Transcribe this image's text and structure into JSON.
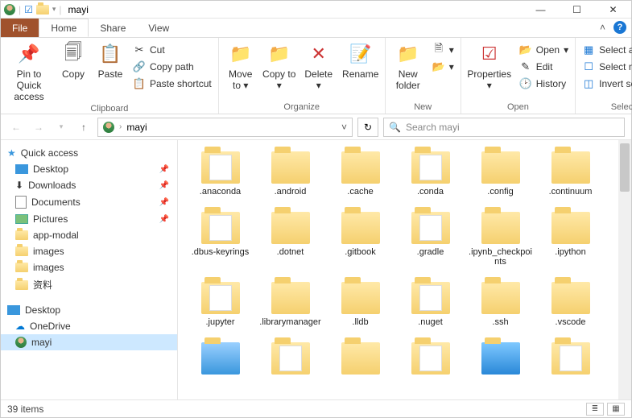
{
  "title": "mayi",
  "tabs": {
    "file": "File",
    "home": "Home",
    "share": "Share",
    "view": "View"
  },
  "ribbon": {
    "pin": "Pin to Quick access",
    "copy": "Copy",
    "paste": "Paste",
    "cut": "Cut",
    "copypath": "Copy path",
    "pasteshortcut": "Paste shortcut",
    "clipboard": "Clipboard",
    "moveto": "Move to",
    "copyto": "Copy to",
    "delete": "Delete",
    "rename": "Rename",
    "organize": "Organize",
    "newfolder": "New folder",
    "new": "New",
    "properties": "Properties",
    "open_s": "Open",
    "edit": "Edit",
    "history": "History",
    "open": "Open",
    "selectall": "Select all",
    "selectnone": "Select none",
    "invert": "Invert selection",
    "select": "Select"
  },
  "breadcrumb": {
    "item": "mayi"
  },
  "search_placeholder": "Search mayi",
  "nav": {
    "quick": "Quick access",
    "desktop": "Desktop",
    "downloads": "Downloads",
    "documents": "Documents",
    "pictures": "Pictures",
    "appmodal": "app-modal",
    "images1": "images",
    "images2": "images",
    "ziliao": "资料",
    "desktop2": "Desktop",
    "onedrive": "OneDrive",
    "mayi": "mayi"
  },
  "folders": [
    ".anaconda",
    ".android",
    ".cache",
    ".conda",
    ".config",
    ".continuum",
    ".dbus-keyrings",
    ".dotnet",
    ".gitbook",
    ".gradle",
    ".ipynb_checkpoints",
    ".ipython",
    ".jupyter",
    ".librarymanager",
    ".lldb",
    ".nuget",
    ".ssh",
    ".vscode"
  ],
  "status": {
    "count": "39 items"
  }
}
